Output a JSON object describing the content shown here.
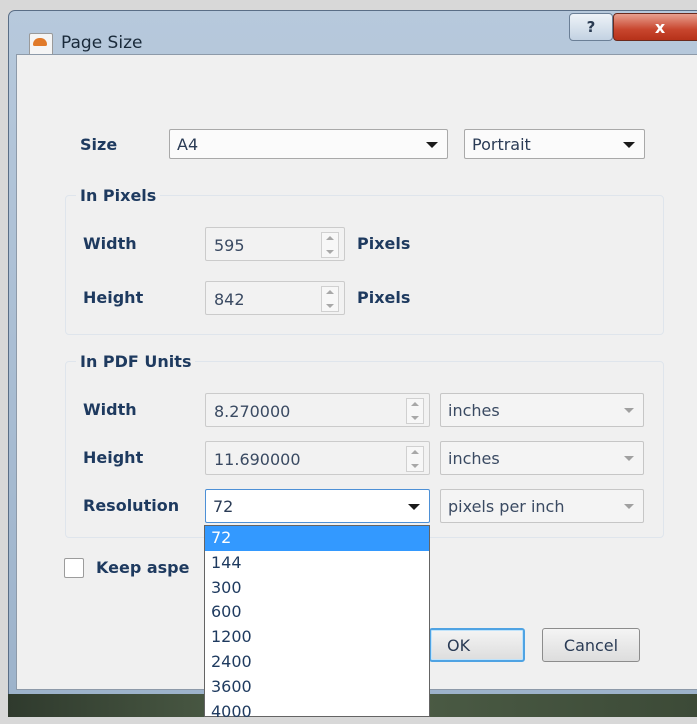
{
  "window": {
    "title": "Page Size",
    "help_label": "?",
    "close_label": "x"
  },
  "size": {
    "label": "Size",
    "value": "A4",
    "orientation": "Portrait"
  },
  "in_pixels": {
    "title": "In Pixels",
    "width_label": "Width",
    "width_value": "595",
    "width_unit": "Pixels",
    "height_label": "Height",
    "height_value": "842",
    "height_unit": "Pixels"
  },
  "in_pdf_units": {
    "title": "In PDF Units",
    "width_label": "Width",
    "width_value": "8.270000",
    "width_unit": "inches",
    "height_label": "Height",
    "height_value": "11.690000",
    "height_unit": "inches",
    "resolution_label": "Resolution",
    "resolution_value": "72",
    "resolution_unit": "pixels per inch"
  },
  "keep_aspect": {
    "label": "Keep aspe",
    "checked": false
  },
  "buttons": {
    "ok": "OK",
    "cancel": "Cancel"
  },
  "resolution_options": [
    "72",
    "144",
    "300",
    "600",
    "1200",
    "2400",
    "3600",
    "4000"
  ],
  "colors": {
    "selection": "#3399ff",
    "close_button": "#c8452d"
  }
}
